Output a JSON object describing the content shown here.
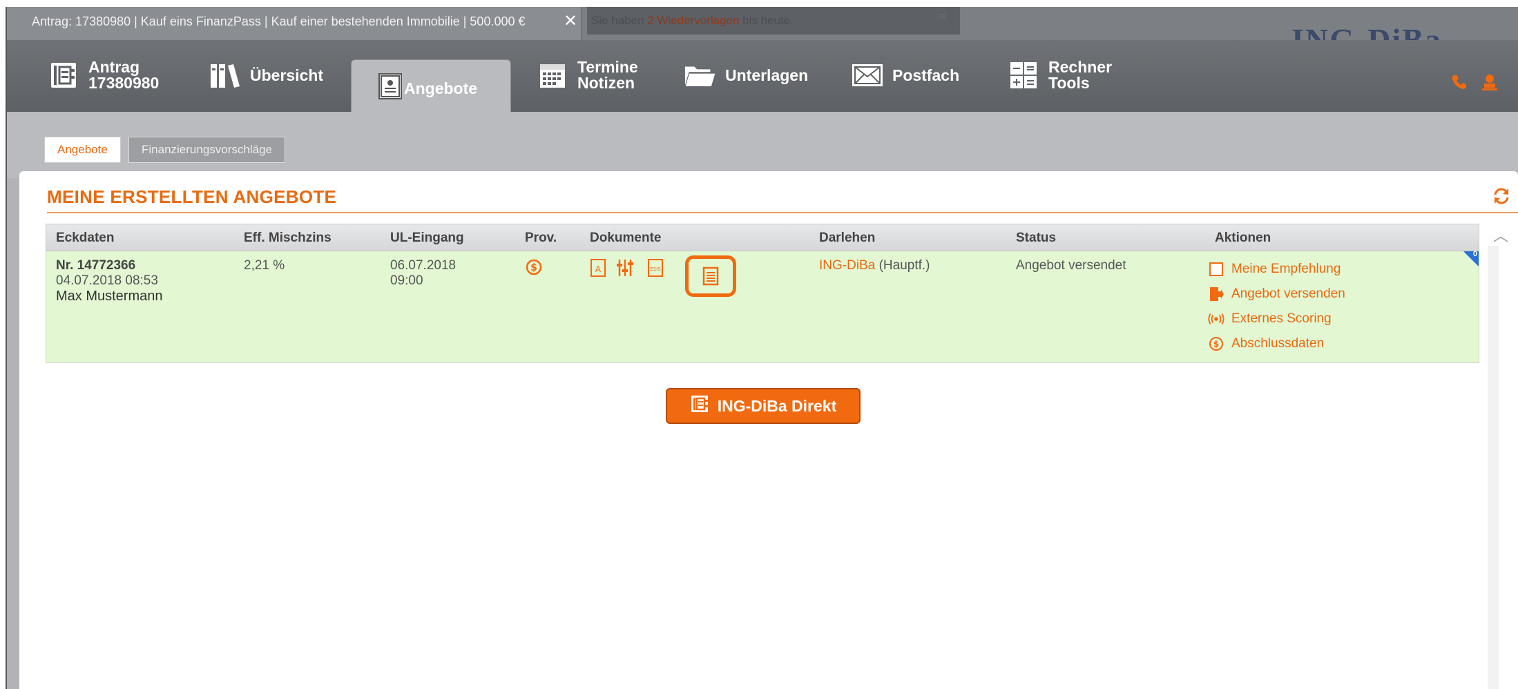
{
  "window": {
    "app_tab_title": "Antrag: 17380980 | Kauf eins FinanzPass | Kauf einer bestehenden Immobilie | 500.000 €",
    "close_glyph": "✕",
    "notice_prefix": "Sie haben ",
    "notice_highlight": "2 Wiedervorlagen",
    "notice_suffix": " bis heute.",
    "notice_collapse_glyph": "≈",
    "logo_text": "ING-DiBa"
  },
  "nav": {
    "items": [
      {
        "line1": "Antrag",
        "line2": "17380980",
        "icon": "address-book-icon"
      },
      {
        "label": "Übersicht",
        "icon": "binders-icon"
      },
      {
        "label": "Angebote",
        "icon": "offer-document-icon"
      },
      {
        "line1": "Termine",
        "line2": "Notizen",
        "icon": "calendar-icon"
      },
      {
        "label": "Unterlagen",
        "icon": "folder-icon"
      },
      {
        "label": "Postfach",
        "icon": "envelope-icon"
      },
      {
        "line1": "Rechner",
        "line2": "Tools",
        "icon": "calculator-icon"
      }
    ],
    "right_icons": [
      "phone-icon",
      "user-icon"
    ]
  },
  "subtabs": {
    "active": "Angebote",
    "inactive": "Finanzierungsvorschläge"
  },
  "panel": {
    "title": "MEINE ERSTELLTEN ANGEBOTE",
    "columns": [
      "Eckdaten",
      "Eff. Mischzins",
      "UL-Eingang",
      "Prov.",
      "Dokumente",
      "Darlehen",
      "Status",
      "Aktionen"
    ],
    "row": {
      "number": "Nr. 14772366",
      "created": "04.07.2018 08:53",
      "customer": "Max Mustermann",
      "rate": "2,21 %",
      "ul_date": "06.07.2018",
      "ul_time": "09:00",
      "lender_link": "ING-DiBa",
      "lender_suffix": " (Hauptf.)",
      "status": "Angebot versendet",
      "corner_count": "0",
      "actions": [
        {
          "label": "Meine Empfehlung",
          "icon": "checkbox-icon"
        },
        {
          "label": "Angebot versenden",
          "icon": "send-door-icon"
        },
        {
          "label": "Externes Scoring",
          "icon": "broadcast-icon"
        },
        {
          "label": "Abschlussdaten",
          "icon": "dollar-circle-icon"
        }
      ]
    }
  },
  "direct_button": "ING-DiBa Direkt",
  "colors": {
    "accent": "#e86a10",
    "row_bg": "#e2f7d2",
    "nav_bg": "#5d6064"
  }
}
